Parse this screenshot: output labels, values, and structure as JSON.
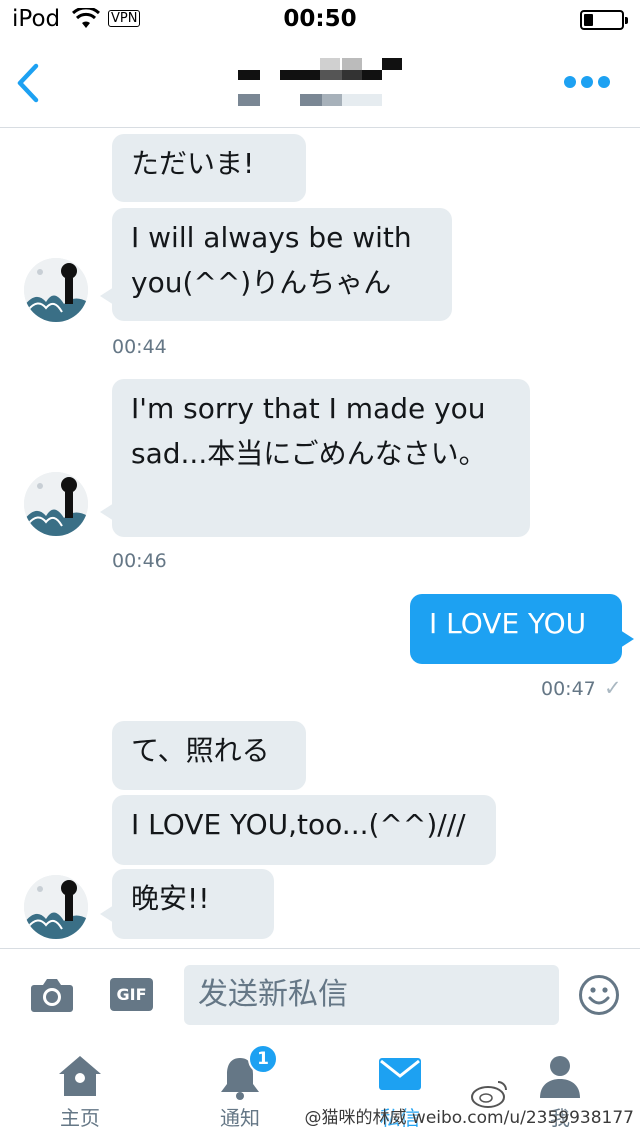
{
  "status_bar": {
    "carrier": "iPod",
    "vpn": "VPN",
    "time": "00:50",
    "battery_level": 0.25
  },
  "header": {
    "back_icon": "chevron-left-icon",
    "more_icon": "more-dots-icon",
    "accent_color": "#1da1f2"
  },
  "messages": [
    {
      "direction": "in",
      "text": "ただいま!"
    },
    {
      "direction": "in",
      "text": "I will always be with you(^^)りんちゃん"
    },
    {
      "timestamp": "00:44"
    },
    {
      "direction": "in",
      "text": "I'm sorry that I made you sad...本当にごめんなさい。"
    },
    {
      "timestamp": "00:46"
    },
    {
      "direction": "out",
      "text": "I LOVE YOU"
    },
    {
      "timestamp": "00:47",
      "check": "✓"
    },
    {
      "direction": "in",
      "text": "て、照れる"
    },
    {
      "direction": "in",
      "text": "I LOVE YOU,too...(^^)///"
    },
    {
      "direction": "in",
      "text": "晚安!!"
    }
  ],
  "composer": {
    "camera_icon": "camera-icon",
    "gif_label": "GIF",
    "placeholder": "发送新私信",
    "emoji_icon": "smiley-icon"
  },
  "tabs": [
    {
      "label": "主页",
      "icon": "home-icon",
      "active": false
    },
    {
      "label": "通知",
      "icon": "bell-icon",
      "active": false,
      "badge": "1"
    },
    {
      "label": "私信",
      "icon": "envelope-icon",
      "active": true
    },
    {
      "label": "我",
      "icon": "person-icon",
      "active": false
    }
  ],
  "watermark": "@猫咪的林威 weibo.com/u/2359938177"
}
